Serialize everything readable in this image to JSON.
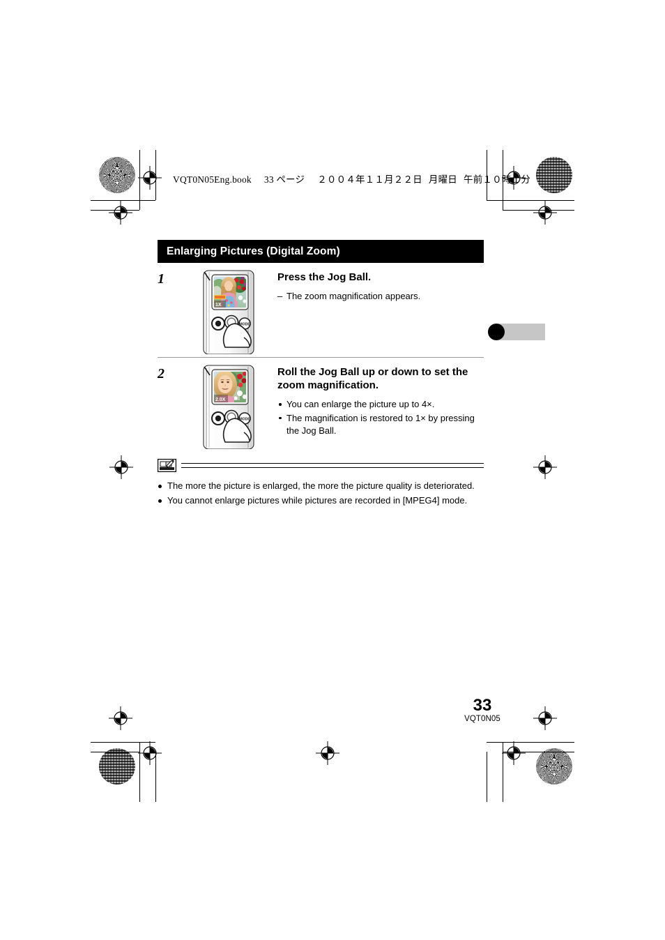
{
  "page_header": {
    "file": "VQT0N05Eng.book",
    "page_label": "33 ページ",
    "date": "２００４年１１月２２日",
    "weekday": "月曜日",
    "time": "午前１０時１分"
  },
  "section": {
    "title": "Enlarging Pictures (Digital Zoom)"
  },
  "steps": [
    {
      "number": "1",
      "heading": "Press the Jog Ball.",
      "dash_note": "The zoom magnification appears.",
      "dash_marker": "–",
      "screen_overlay": "1X",
      "mode_button_label": "MODE"
    },
    {
      "number": "2",
      "heading": "Roll the Jog Ball up or down to set the zoom magnification.",
      "bullets": [
        "You can enlarge the picture up to 4×.",
        "The magnification is restored to 1× by pressing the Jog Ball."
      ],
      "screen_overlay": "2.0X",
      "mode_button_label": "MODE"
    }
  ],
  "notes": {
    "icon": "note-pencil-icon",
    "items": [
      "The more the picture is enlarged, the more the picture quality is deteriorated.",
      "You cannot enlarge pictures while pictures are recorded in [MPEG4] mode."
    ]
  },
  "thumb_index": {
    "marker": "chapter-thumb-index",
    "dot_color": "#000000",
    "bar_color": "#c6c6c6"
  },
  "footer": {
    "page_number": "33",
    "document_id": "VQT0N05"
  }
}
